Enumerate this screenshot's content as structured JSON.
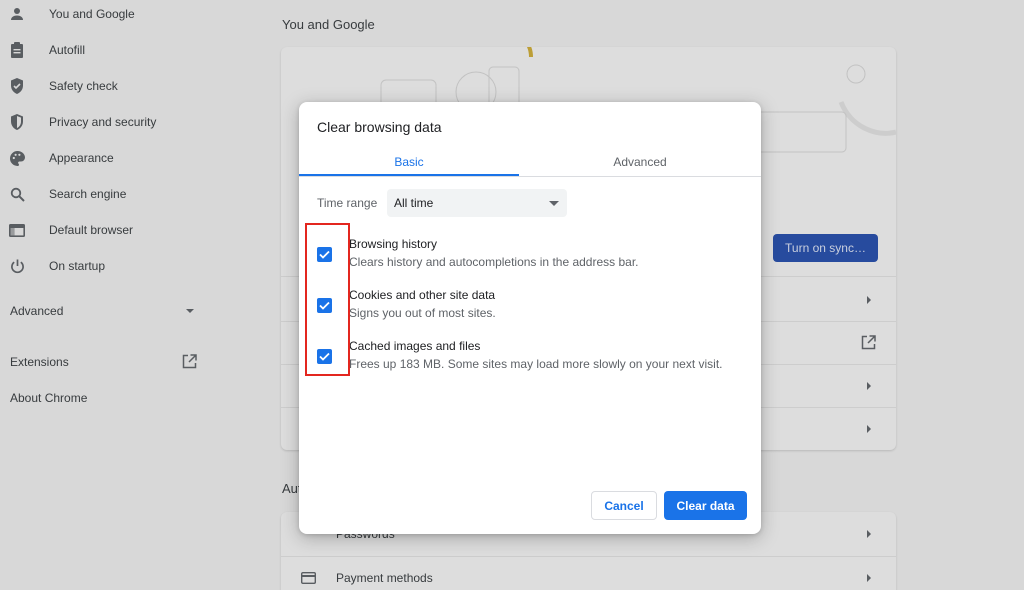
{
  "sidebar": {
    "items": [
      {
        "label": "You and Google",
        "icon": "person-icon"
      },
      {
        "label": "Autofill",
        "icon": "clipboard-icon"
      },
      {
        "label": "Safety check",
        "icon": "shield-check-icon"
      },
      {
        "label": "Privacy and security",
        "icon": "shield-icon"
      },
      {
        "label": "Appearance",
        "icon": "palette-icon"
      },
      {
        "label": "Search engine",
        "icon": "search-icon"
      },
      {
        "label": "Default browser",
        "icon": "browser-icon"
      },
      {
        "label": "On startup",
        "icon": "power-icon"
      }
    ],
    "advanced": "Advanced",
    "extensions": "Extensions",
    "about": "About Chrome"
  },
  "main": {
    "section_you_and_google": "You and Google",
    "sync_button": "Turn on sync…",
    "section_autofill_partial": "Aut",
    "passwords_partial": "Passwords",
    "payment_methods": "Payment methods"
  },
  "dialog": {
    "title": "Clear browsing data",
    "tabs": {
      "basic": "Basic",
      "advanced": "Advanced"
    },
    "time_range": {
      "label": "Time range",
      "value": "All time"
    },
    "options": [
      {
        "title": "Browsing history",
        "desc": "Clears history and autocompletions in the address bar.",
        "checked": true
      },
      {
        "title": "Cookies and other site data",
        "desc": "Signs you out of most sites.",
        "checked": true
      },
      {
        "title": "Cached images and files",
        "desc": "Frees up 183 MB. Some sites may load more slowly on your next visit.",
        "checked": true
      }
    ],
    "cancel": "Cancel",
    "clear": "Clear data"
  },
  "colors": {
    "accent": "#1a73e8",
    "highlight": "#e3261f"
  }
}
